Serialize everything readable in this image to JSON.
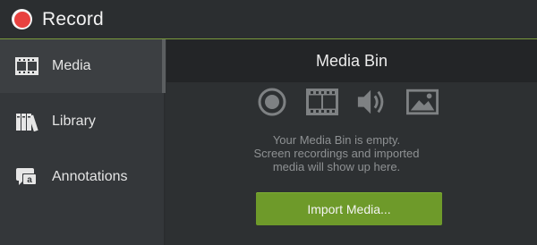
{
  "topbar": {
    "record_label": "Record"
  },
  "sidebar": {
    "items": [
      {
        "label": "Media",
        "icon": "film-strip-icon",
        "active": true
      },
      {
        "label": "Library",
        "icon": "books-icon",
        "active": false
      },
      {
        "label": "Annotations",
        "icon": "annotation-icon",
        "active": false
      }
    ]
  },
  "main": {
    "title": "Media Bin",
    "media_icons": [
      "record-icon",
      "video-icon",
      "audio-icon",
      "image-icon"
    ],
    "empty_line1": "Your Media Bin is empty.",
    "empty_line2": "Screen recordings and imported",
    "empty_line3": "media will show up here.",
    "import_label": "Import Media..."
  },
  "colors": {
    "accent_green": "#6e9a2a",
    "record_red": "#e8413f"
  }
}
